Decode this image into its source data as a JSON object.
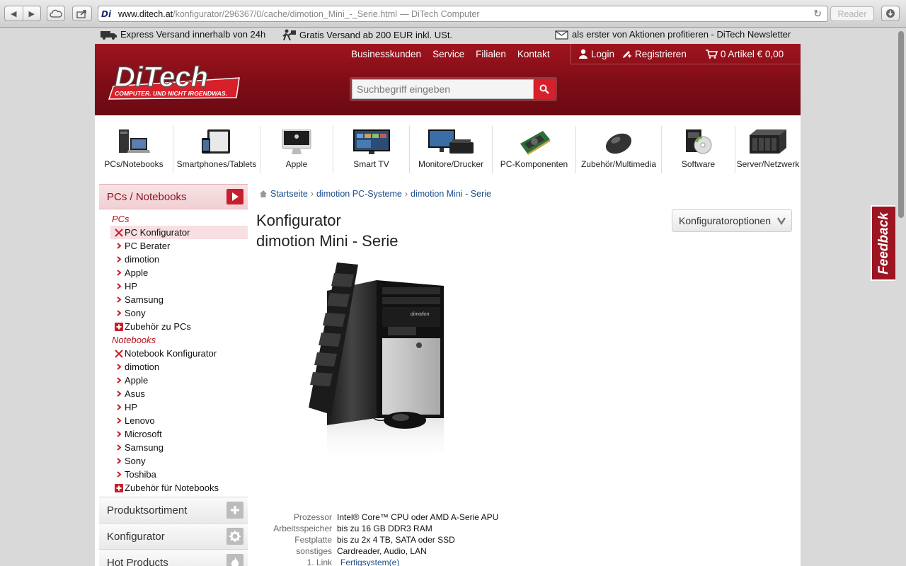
{
  "browser": {
    "url_domain": "www.ditech.at",
    "url_path": "/konfigurator/296367/0/cache/dimotion_Mini_-_Serie.html",
    "page_title": "— DiTech Computer",
    "reader_label": "Reader",
    "favicon_text": "Di"
  },
  "info_strip": {
    "express": "Express Versand innerhalb von 24h",
    "free_shipping": "Gratis Versand ab 200 EUR inkl. USt.",
    "newsletter": "als erster von Aktionen profitieren - DiTech Newsletter"
  },
  "header": {
    "logo_name": "DiTech",
    "logo_tagline": "COMPUTER. UND NICHT IRGENDWAS.",
    "nav": [
      "Businesskunden",
      "Service",
      "Filialen",
      "Kontakt"
    ],
    "login": "Login",
    "register": "Registrieren",
    "cart": "0 Artikel € 0,00",
    "search_placeholder": "Suchbegriff eingeben"
  },
  "categories": [
    {
      "label": "PCs/Notebooks",
      "icon": "pc-notebook-icon"
    },
    {
      "label": "Smartphones/Tablets",
      "icon": "smartphone-tablet-icon"
    },
    {
      "label": "Apple",
      "icon": "imac-icon"
    },
    {
      "label": "Smart TV",
      "icon": "tv-icon"
    },
    {
      "label": "Monitore/Drucker",
      "icon": "monitor-printer-icon"
    },
    {
      "label": "PC-Komponenten",
      "icon": "graphics-card-icon"
    },
    {
      "label": "Zubehör/Multimedia",
      "icon": "mouse-icon"
    },
    {
      "label": "Software",
      "icon": "software-box-icon"
    },
    {
      "label": "Server/Netzwerk",
      "icon": "server-icon"
    }
  ],
  "sidebar": {
    "heading": "PCs / Notebooks",
    "pcs_heading": "PCs",
    "pcs_items": [
      {
        "label": "PC Konfigurator",
        "marker": "tools",
        "active": true
      },
      {
        "label": "PC Berater",
        "marker": "arrow"
      },
      {
        "label": "dimotion",
        "marker": "arrow"
      },
      {
        "label": "Apple",
        "marker": "arrow"
      },
      {
        "label": "HP",
        "marker": "arrow"
      },
      {
        "label": "Samsung",
        "marker": "arrow"
      },
      {
        "label": "Sony",
        "marker": "arrow"
      },
      {
        "label": "Zubehör zu PCs",
        "marker": "plus"
      }
    ],
    "notebooks_heading": "Notebooks",
    "notebook_items": [
      {
        "label": "Notebook Konfigurator",
        "marker": "tools"
      },
      {
        "label": "dimotion",
        "marker": "arrow"
      },
      {
        "label": "Apple",
        "marker": "arrow"
      },
      {
        "label": "Asus",
        "marker": "arrow"
      },
      {
        "label": "HP",
        "marker": "arrow"
      },
      {
        "label": "Lenovo",
        "marker": "arrow"
      },
      {
        "label": "Microsoft",
        "marker": "arrow"
      },
      {
        "label": "Samsung",
        "marker": "arrow"
      },
      {
        "label": "Sony",
        "marker": "arrow"
      },
      {
        "label": "Toshiba",
        "marker": "arrow"
      },
      {
        "label": "Zubehör für Notebooks",
        "marker": "plus"
      }
    ],
    "sections": [
      {
        "label": "Produktsortiment",
        "icon": "plus-icon"
      },
      {
        "label": "Konfigurator",
        "icon": "gear-icon"
      },
      {
        "label": "Hot Products",
        "icon": "flame-icon"
      }
    ]
  },
  "breadcrumb": [
    "Startseite",
    "dimotion PC-Systeme",
    "dimotion Mini - Serie"
  ],
  "main": {
    "title_line1": "Konfigurator",
    "title_line2": "dimotion Mini - Serie",
    "options_button": "Konfiguratoroptionen",
    "specs": [
      {
        "key": "Prozessor",
        "value": "Intel® Core™ CPU oder AMD A-Serie APU"
      },
      {
        "key": "Arbeitsspeicher",
        "value": "bis zu 16 GB DDR3 RAM"
      },
      {
        "key": "Festplatte",
        "value": "bis zu 2x 4 TB, SATA oder SSD"
      },
      {
        "key": "sonstiges",
        "value": "Cardreader, Audio, LAN"
      }
    ],
    "link_row_key": "1. Link",
    "link_row_value": "Fertigsystem(e)"
  },
  "feedback_label": "Feedback"
}
